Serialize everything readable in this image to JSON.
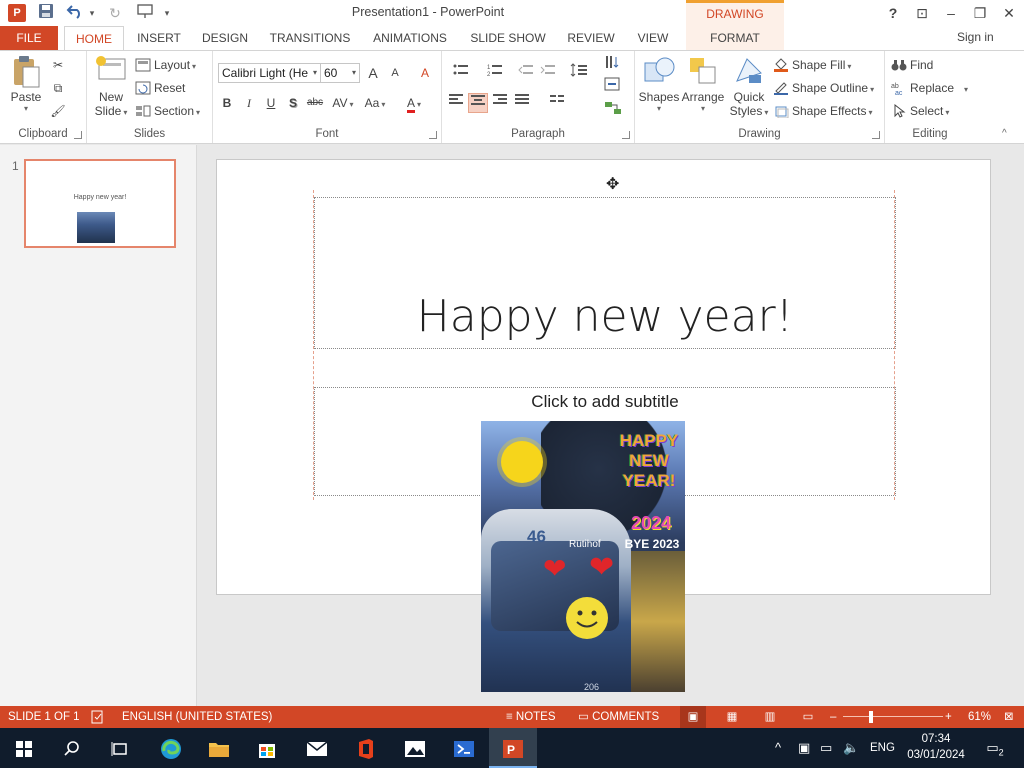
{
  "window": {
    "title": "Presentation1 - PowerPoint",
    "contextual_tab_group": "DRAWING TOOLS",
    "help": "?",
    "ribbon_display": "⊡",
    "minimize": "–",
    "restore": "❐",
    "close": "✕",
    "sign_in": "Sign in"
  },
  "qat": {
    "app_icon": "P",
    "save": "💾",
    "undo": "↶",
    "undo_dropdown": "▾",
    "redo": "↻",
    "start_from_beginning": "⊡",
    "customize": "▾"
  },
  "tabs": [
    {
      "id": "file",
      "label": "FILE"
    },
    {
      "id": "home",
      "label": "HOME"
    },
    {
      "id": "insert",
      "label": "INSERT"
    },
    {
      "id": "design",
      "label": "DESIGN"
    },
    {
      "id": "transitions",
      "label": "TRANSITIONS"
    },
    {
      "id": "animations",
      "label": "ANIMATIONS"
    },
    {
      "id": "slideshow",
      "label": "SLIDE SHOW"
    },
    {
      "id": "review",
      "label": "REVIEW"
    },
    {
      "id": "view",
      "label": "VIEW"
    },
    {
      "id": "format",
      "label": "FORMAT"
    }
  ],
  "ribbon": {
    "clipboard": {
      "label": "Clipboard",
      "paste": "Paste",
      "cut": "✂",
      "copy": "⧉",
      "format_painter": "🖌"
    },
    "slides": {
      "label": "Slides",
      "new_slide_line1": "New",
      "new_slide_line2": "Slide",
      "layout": "Layout",
      "reset": "Reset",
      "section": "Section"
    },
    "font": {
      "label": "Font",
      "font_name": "Calibri Light (He",
      "font_size": "60",
      "grow": "A",
      "shrink": "A",
      "clear": "A",
      "bold": "B",
      "italic": "I",
      "underline": "U",
      "shadow": "S",
      "strike": "abc",
      "spacing": "AV",
      "case": "Aa",
      "color": "A"
    },
    "paragraph": {
      "label": "Paragraph"
    },
    "drawing": {
      "label": "Drawing",
      "shapes": "Shapes",
      "arrange": "Arrange",
      "quick_styles_line1": "Quick",
      "quick_styles_line2": "Styles",
      "shape_fill": "Shape Fill",
      "shape_outline": "Shape Outline",
      "shape_effects": "Shape Effects"
    },
    "editing": {
      "label": "Editing",
      "find": "Find",
      "replace": "Replace",
      "select": "Select"
    },
    "collapse": "^"
  },
  "thumbnails": [
    {
      "number": "1",
      "title": "Happy new year!"
    }
  ],
  "slide": {
    "title": "Happy new year!",
    "subtitle_placeholder": "Click to add subtitle",
    "photo": {
      "greeting": "HAPPY NEW YEAR!",
      "year": "2024",
      "bye": "BYE 2023",
      "route": "46",
      "destination": "Rütihof",
      "vehicle": "206"
    }
  },
  "status": {
    "slide": "SLIDE 1 OF 1",
    "language": "ENGLISH (UNITED STATES)",
    "notes": "NOTES",
    "comments": "COMMENTS",
    "zoom_minus": "–",
    "zoom_plus": "+",
    "zoom": "61%"
  },
  "taskbar": {
    "language": "ENG",
    "time": "07:34",
    "date": "03/01/2024",
    "notifications": "2"
  },
  "colors": {
    "accent": "#d24726",
    "taskbar": "#101c2c",
    "contextual_tab": "#f0a030"
  }
}
